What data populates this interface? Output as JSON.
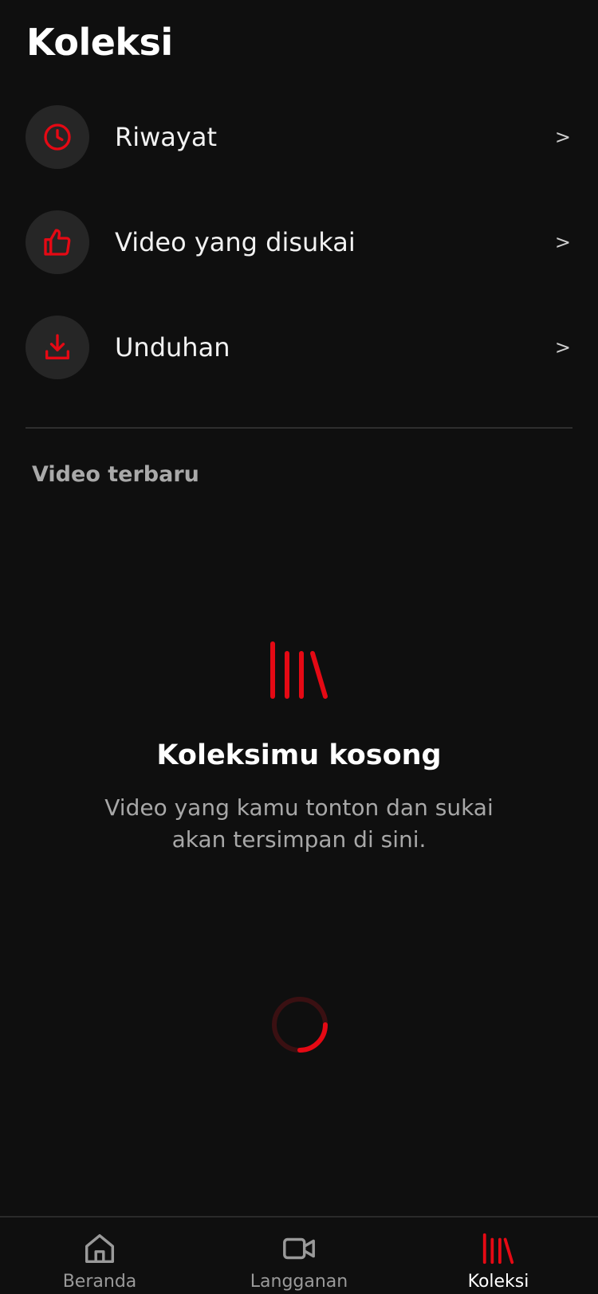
{
  "header": {
    "title": "Koleksi"
  },
  "menu": {
    "items": [
      {
        "label": "Riwayat",
        "icon": "clock-icon",
        "chevron": ">"
      },
      {
        "label": "Video yang disukai",
        "icon": "thumbs-up-icon",
        "chevron": ">"
      },
      {
        "label": "Unduhan",
        "icon": "download-icon",
        "chevron": ">"
      }
    ]
  },
  "section": {
    "title": "Video terbaru"
  },
  "empty_state": {
    "icon": "library-icon",
    "title": "Koleksimu kosong",
    "description": "Video yang kamu tonton dan sukai akan tersimpan di sini."
  },
  "loading": {
    "icon": "spinner-icon"
  },
  "bottom_nav": {
    "items": [
      {
        "label": "Beranda",
        "icon": "home-icon",
        "active": false
      },
      {
        "label": "Langganan",
        "icon": "video-camera-icon",
        "active": false
      },
      {
        "label": "Koleksi",
        "icon": "library-icon",
        "active": true
      }
    ]
  },
  "colors": {
    "background": "#0f0f0f",
    "accent": "#e50914",
    "icon_circle": "#262626",
    "muted_text": "#a8a8a8",
    "nav_inactive": "#9a9a9a"
  }
}
